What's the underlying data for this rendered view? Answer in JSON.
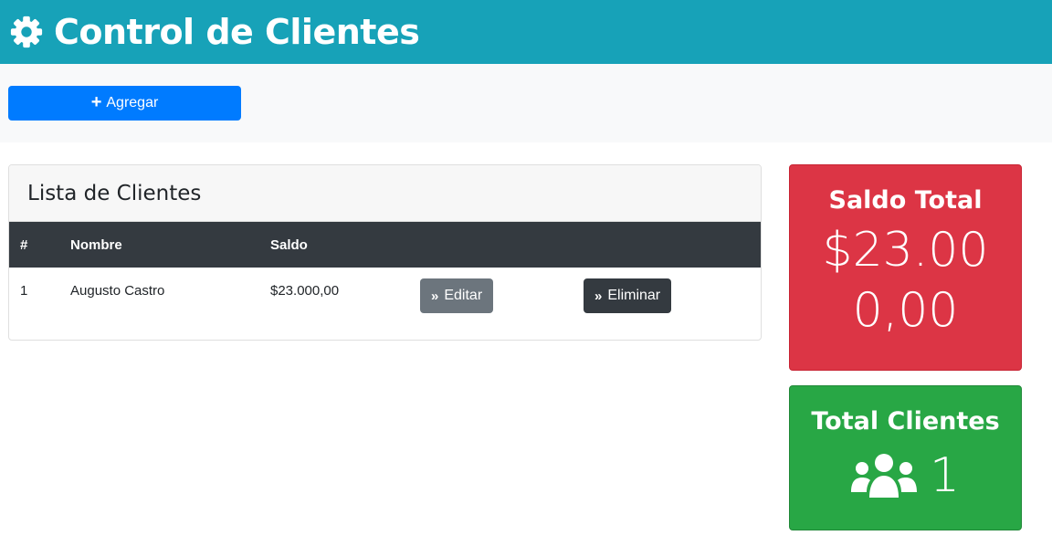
{
  "header": {
    "title": "Control de Clientes",
    "icon": "gear-icon"
  },
  "toolbar": {
    "add_label": "Agregar",
    "add_icon": "plus-icon"
  },
  "clients_card": {
    "title": "Lista de Clientes",
    "columns": [
      "#",
      "Nombre",
      "Saldo"
    ],
    "rows": [
      {
        "index": "1",
        "name": "Augusto Castro",
        "balance": "$23.000,00"
      }
    ],
    "edit_label": "Editar",
    "delete_label": "Eliminar"
  },
  "saldo_total": {
    "title": "Saldo Total",
    "value": "$23.000,00"
  },
  "total_clientes": {
    "title": "Total Clientes",
    "value": "1",
    "icon": "users-icon"
  },
  "colors": {
    "header": "#17a2b8",
    "primary": "#007bff",
    "danger": "#dc3545",
    "success": "#28a745",
    "secondary": "#6c757d",
    "dark": "#343a40"
  }
}
